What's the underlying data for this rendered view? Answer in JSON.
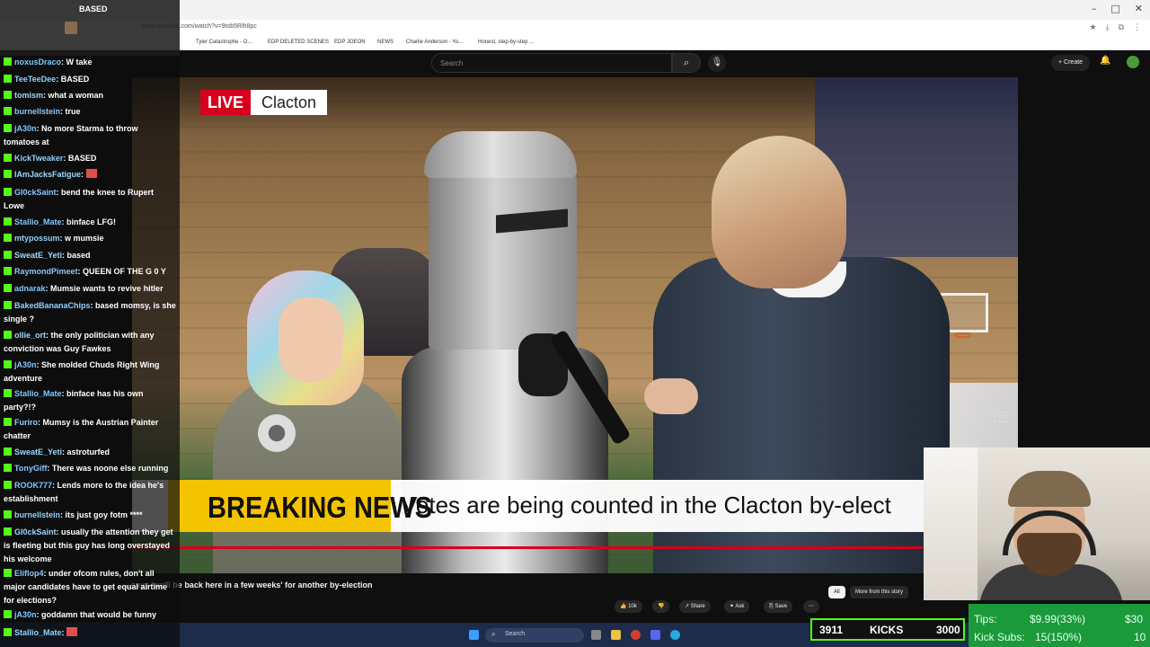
{
  "browser": {
    "profile_label": "BASED",
    "url": "www.youtube.com/watch?v=9tob5Rlh8pc",
    "bookmarks": [
      "Tyler Catastrophe - O...",
      "EDP DELETED SCENES",
      "EDP JOEON",
      "NEWS",
      "Charlie Anderson - Yo...",
      "Honest, step-by-step ..."
    ],
    "window_controls": [
      "–",
      "□",
      "✕"
    ]
  },
  "youtube": {
    "search_placeholder": "Search",
    "create_label": "Create",
    "video_title": "…says 'we'll be back here in a few weeks' for another by-election",
    "likes": "10k",
    "share_label": "Share",
    "ask_label": "Ask",
    "save_label": "Save",
    "chip_all": "All",
    "chip_more": "More from this story"
  },
  "video": {
    "live_tag": "LIVE",
    "location": "Clacton",
    "breaking_label": "BREAKING NEWS",
    "ticker_text": "Votes are being counted in the Clacton by-elect"
  },
  "chat": {
    "messages": [
      {
        "user": "noxusDraco",
        "text": "W take"
      },
      {
        "user": "TeeTeeDee",
        "text": "BASED"
      },
      {
        "user": "tomism",
        "text": "what a woman"
      },
      {
        "user": "burnellstein",
        "text": "true"
      },
      {
        "user": "jA30n",
        "text": "No more Starma to throw tomatoes at"
      },
      {
        "user": "KickTweaker",
        "text": "BASED"
      },
      {
        "user": "IAmJacksFatigue",
        "text": ""
      },
      {
        "user": "Gl0ckSaint",
        "text": "bend the knee to Rupert Lowe"
      },
      {
        "user": "Stallio_Mate",
        "text": "binface LFG!"
      },
      {
        "user": "mtypossum",
        "text": "w mumsie"
      },
      {
        "user": "SweatE_Yeti",
        "text": "based"
      },
      {
        "user": "RaymondPimeet",
        "text": "QUEEN OF THE G 0 Y"
      },
      {
        "user": "adnarak",
        "text": "Mumsie wants to revive hitler"
      },
      {
        "user": "BakedBananaChips",
        "text": "based momsy, is she single ?"
      },
      {
        "user": "ollie_ort",
        "text": "the only politician with any conviction was Guy Fawkes"
      },
      {
        "user": "jA30n",
        "text": "She molded Chuds Right Wing adventure"
      },
      {
        "user": "Stallio_Mate",
        "text": "binface has his own party?!?"
      },
      {
        "user": "Furiro",
        "text": "Mumsy is the Austrian Painter chatter"
      },
      {
        "user": "SweatE_Yeti",
        "text": "astroturfed"
      },
      {
        "user": "TonyGiff",
        "text": "There was noone else running"
      },
      {
        "user": "ROOK777",
        "text": "Lends more to the idea he's establishment"
      },
      {
        "user": "burnellstein",
        "text": "its just goy fotm ****"
      },
      {
        "user": "Gl0ckSaint",
        "text": "usually the attention they get is fleeting but this guy has long overstayed his welcome"
      },
      {
        "user": "Eliflop4",
        "text": "under ofcom rules, don't all major candidates have to get equal airtime for elections?"
      },
      {
        "user": "jA30n",
        "text": "goddamn that would be funny"
      },
      {
        "user": "Stallio_Mate",
        "text": ""
      }
    ]
  },
  "taskbar": {
    "search_label": "Search"
  },
  "stream_widgets": {
    "kicks_current": "3911",
    "kicks_label": "KICKS",
    "kicks_goal": "3000",
    "tips_label": "Tips:",
    "tips_value": "$9.99(33%)",
    "tips_goal": "$30",
    "subs_label": "Kick Subs:",
    "subs_value": "15(150%)",
    "subs_goal": "10"
  },
  "colors": {
    "kick_green": "#53fc18",
    "live_red": "#d6001c",
    "breaking_yellow": "#f5c400"
  }
}
